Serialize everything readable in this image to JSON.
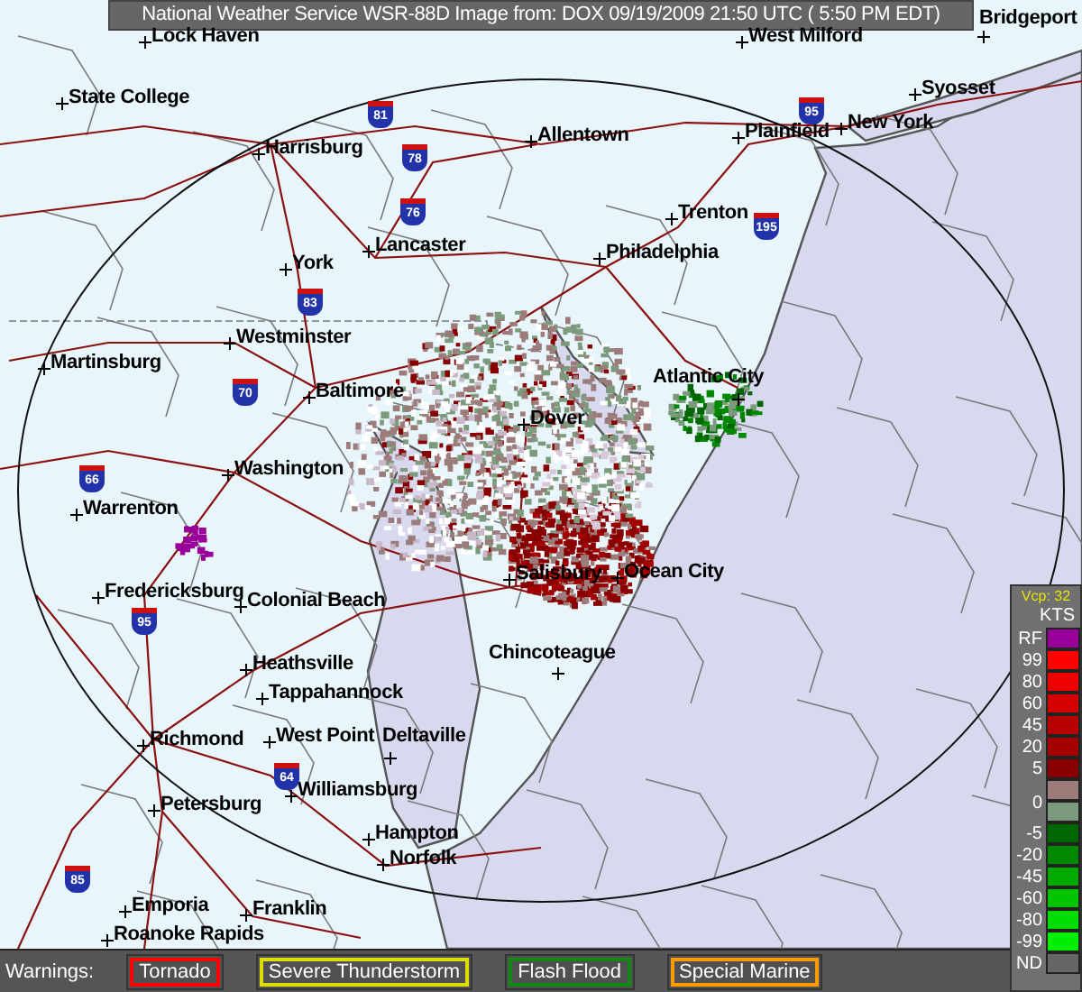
{
  "header": {
    "title": "National Weather Service WSR-88D Image from: DOX 09/19/2009 21:50 UTC ( 5:50 PM EDT)"
  },
  "cities": [
    "Lock Haven",
    "West Milford",
    "Bridgeport",
    "State College",
    "Syosset",
    "Allentown",
    "Plainfield",
    "New York",
    "Harrisburg",
    "Trenton",
    "Lancaster",
    "Philadelphia",
    "York",
    "Westminster",
    "Martinsburg",
    "Atlantic City",
    "Baltimore",
    "Dover",
    "Washington",
    "Warrenton",
    "Fredericksburg",
    "Colonial Beach",
    "Salisbury",
    "Ocean City",
    "Chincoteague",
    "Heathsville",
    "Tappahannock",
    "Richmond",
    "West Point",
    "Deltaville",
    "Williamsburg",
    "Petersburg",
    "Hampton",
    "Norfolk",
    "Emporia",
    "Franklin",
    "Roanoke Rapids"
  ],
  "interstates": [
    "81",
    "78",
    "95",
    "76",
    "195",
    "83",
    "70",
    "66",
    "95",
    "64",
    "85"
  ],
  "legend": {
    "title": "Vcp: 32",
    "unit": "KTS",
    "bins": [
      {
        "label": "RF",
        "color": "#990099"
      },
      {
        "label": "99",
        "color": "#ff0000"
      },
      {
        "label": "80",
        "color": "#ee0000"
      },
      {
        "label": "60",
        "color": "#d40000"
      },
      {
        "label": "45",
        "color": "#b80000"
      },
      {
        "label": "20",
        "color": "#a40000"
      },
      {
        "label": "5",
        "color": "#880000"
      },
      {
        "label": "0",
        "color": "#9c7c7a"
      },
      {
        "color": "#7c9a7c"
      },
      {
        "label": "-5",
        "color": "#006600"
      },
      {
        "label": "-20",
        "color": "#008800"
      },
      {
        "label": "-45",
        "color": "#00aa00"
      },
      {
        "label": "-60",
        "color": "#00c400"
      },
      {
        "label": "-80",
        "color": "#00dd00"
      },
      {
        "label": "-99",
        "color": "#00ee00"
      },
      {
        "label": "ND",
        "color": "#666666"
      }
    ]
  },
  "warnings": {
    "label": "Warnings:",
    "items": [
      {
        "label": "Tornado",
        "color": "#ff0000"
      },
      {
        "label": "Severe Thunderstorm",
        "color": "#dddd00"
      },
      {
        "label": "Flash Flood",
        "color": "#118811"
      },
      {
        "label": "Special Marine",
        "color": "#ff9900"
      }
    ]
  }
}
